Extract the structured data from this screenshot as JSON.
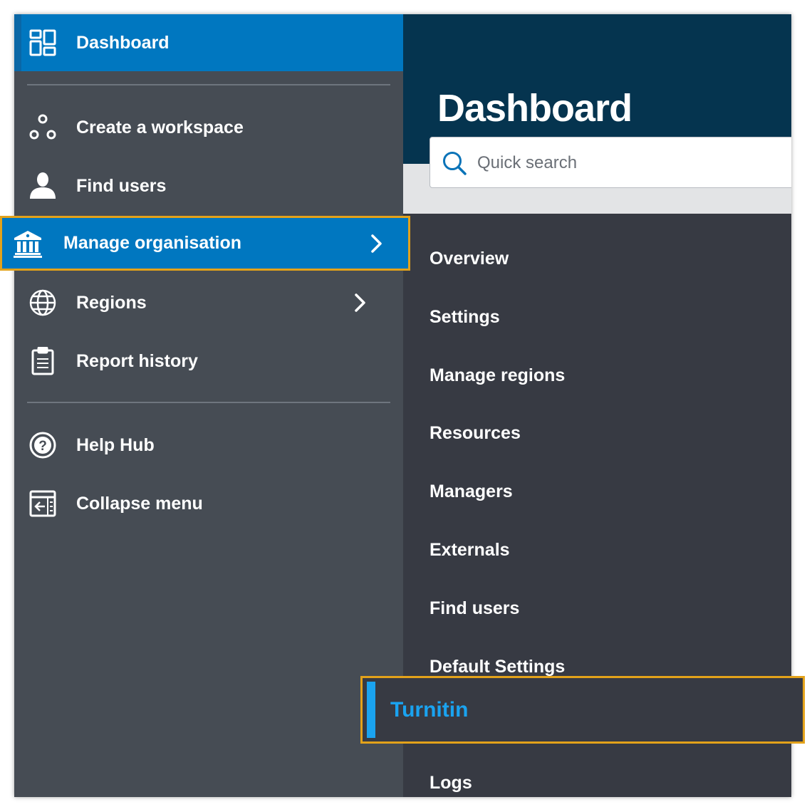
{
  "sidebar": {
    "dashboard_label": "Dashboard",
    "items": [
      {
        "label": "Create a workspace",
        "icon": "workspace-icon"
      },
      {
        "label": "Find users",
        "icon": "user-icon"
      },
      {
        "label": "Manage organisation",
        "icon": "institution-icon",
        "active": true
      },
      {
        "label": "Regions",
        "icon": "globe-icon"
      },
      {
        "label": "Report history",
        "icon": "clipboard-icon"
      },
      {
        "label": "Help Hub",
        "icon": "help-icon"
      },
      {
        "label": "Collapse menu",
        "icon": "collapse-menu-icon"
      }
    ]
  },
  "main": {
    "title": "Dashboard",
    "search": {
      "placeholder": "Quick search"
    }
  },
  "submenu": {
    "items": [
      "Overview",
      "Settings",
      "Manage regions",
      "Resources",
      "Managers",
      "Externals",
      "Find users",
      "Default Settings",
      "Turnitin",
      "Logs"
    ],
    "selected": "Turnitin"
  },
  "colors": {
    "sidebar_bg": "#464c54",
    "active_blue": "#0077c0",
    "header_navy": "#05344f",
    "submenu_bg": "#373a43",
    "highlight_border": "#e3a21a",
    "selected_text": "#1aa3f0"
  }
}
